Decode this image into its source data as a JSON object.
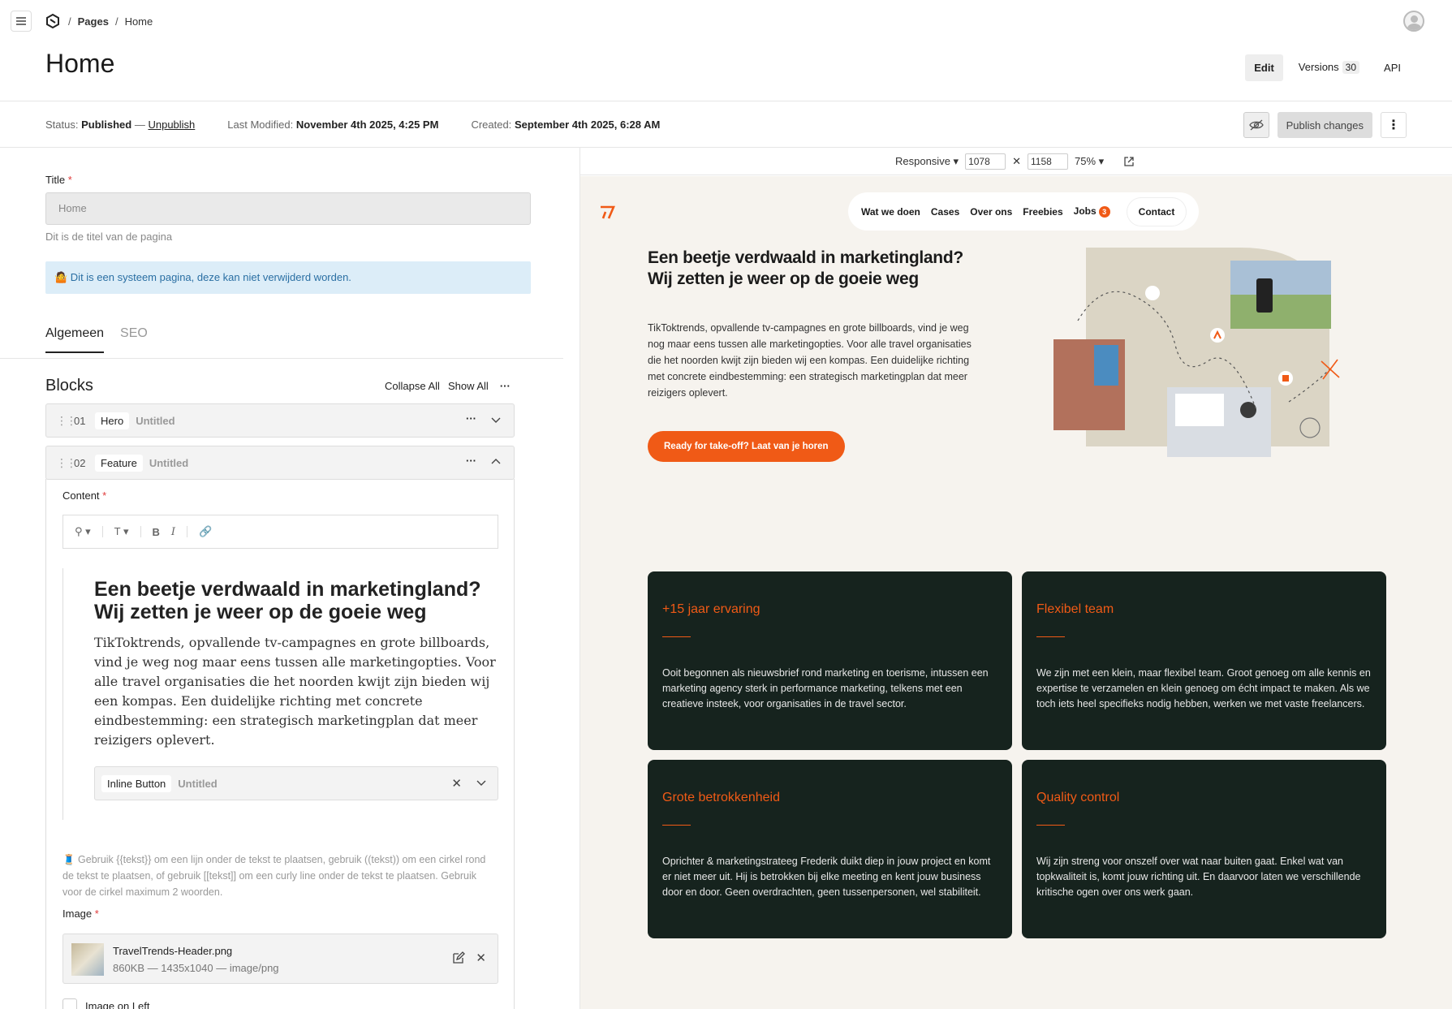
{
  "header": {
    "breadcrumbs": [
      "Pages",
      "Home"
    ],
    "page_title": "Home",
    "tabs": [
      {
        "label": "Edit",
        "active": true
      },
      {
        "label": "Versions",
        "count": "30"
      },
      {
        "label": "API"
      }
    ]
  },
  "status": {
    "status_label": "Status:",
    "status_value": "Published",
    "dash": "—",
    "unpublish": "Unpublish",
    "modified_label": "Last Modified:",
    "modified_value": "November 4th 2025, 4:25 PM",
    "created_label": "Created:",
    "created_value": "September 4th 2025, 6:28 AM",
    "publish_button": "Publish changes"
  },
  "editor": {
    "title_label": "Title",
    "title_value": "Home",
    "title_hint": "Dit is de titel van de pagina",
    "system_info": "🤷 Dit is een systeem pagina, deze kan niet verwijderd worden.",
    "tabs": [
      "Algemeen",
      "SEO"
    ],
    "blocks_title": "Blocks",
    "collapse_all": "Collapse All",
    "show_all": "Show All",
    "blocks": [
      {
        "num": "01",
        "type": "Hero",
        "name": "Untitled"
      },
      {
        "num": "02",
        "type": "Feature",
        "name": "Untitled"
      }
    ],
    "content_label": "Content",
    "rte_heading": "Een beetje verdwaald in marketingland? Wij zetten je weer op de goeie weg",
    "rte_paragraph": "TikToktrends, opvallende tv-campagnes en grote billboards, vind je weg nog maar eens tussen alle marketingopties. Voor alle travel organisaties die het noorden kwijt zijn bieden wij een kompas. Een duidelijke richting met concrete eindbestemming: een strategisch marketingplan dat meer reizigers oplevert.",
    "inline_button_type": "Inline Button",
    "inline_button_name": "Untitled",
    "note": "🧵 Gebruik {{tekst}} om een lijn onder de tekst te plaatsen, gebruik ((tekst)) om een cirkel rond de tekst te plaatsen, of gebruik [[tekst]] om een curly line onder de tekst te plaatsen. Gebruik voor de cirkel maximum 2 woorden.",
    "image_label": "Image",
    "file_name": "TravelTrends-Header.png",
    "file_meta": "860KB — 1435x1040 — image/png",
    "image_left_label": "Image on Left"
  },
  "preview": {
    "mode": "Responsive",
    "width": "1078",
    "height": "1158",
    "zoom": "75%",
    "site": {
      "nav": [
        "Wat we doen",
        "Cases",
        "Over ons",
        "Freebies",
        "Jobs"
      ],
      "jobs_count": "3",
      "contact": "Contact",
      "hero_heading": "Een beetje verdwaald in marketingland? Wij zetten je weer op de goeie weg",
      "hero_paragraph": "TikToktrends, opvallende tv-campagnes en grote billboards, vind je weg nog maar eens tussen alle marketingopties. Voor alle travel organisaties die het noorden kwijt zijn bieden wij een kompas. Een duidelijke richting met concrete eindbestemming: een strategisch marketingplan dat meer reizigers oplevert.",
      "cta": "Ready for take-off? Laat van je horen",
      "cards": [
        {
          "title": "+15 jaar ervaring",
          "text": "Ooit begonnen als nieuwsbrief rond marketing en toerisme, intussen een marketing agency sterk in performance marketing, telkens met een creatieve insteek, voor organisaties in de travel sector."
        },
        {
          "title": "Flexibel team",
          "text": "We zijn met een klein, maar flexibel team. Groot genoeg om alle kennis en expertise te verzamelen en klein genoeg om écht impact te maken. Als we toch iets heel specifieks nodig hebben, werken we met vaste freelancers."
        },
        {
          "title": "Grote betrokkenheid",
          "text": "Oprichter & marketingstrateeg Frederik duikt diep in jouw project en komt er niet meer uit. Hij is betrokken bij elke meeting en kent jouw business door en door. Geen overdrachten, geen tussenpersonen, wel stabiliteit."
        },
        {
          "title": "Quality control",
          "text": "Wij zijn streng voor onszelf over wat naar buiten gaat. Enkel wat van topkwaliteit is, komt jouw richting uit. En daarvoor laten we verschillende kritische ogen over ons werk gaan."
        }
      ]
    }
  },
  "colors": {
    "accent": "#f05a16",
    "card_bg": "#16231e",
    "site_bg": "#f6f3ee",
    "info_bg": "#dcedf8"
  }
}
